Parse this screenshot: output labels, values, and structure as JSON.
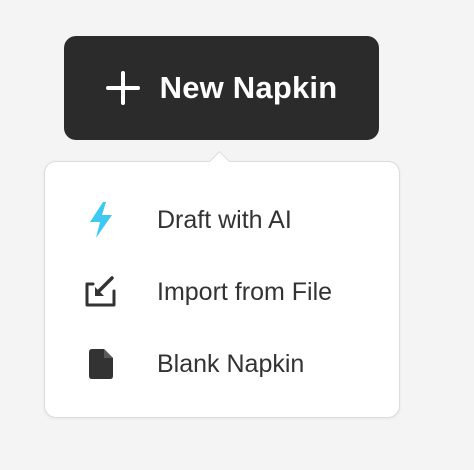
{
  "new_button": {
    "label": "New Napkin",
    "icon": "plus-icon"
  },
  "menu": {
    "items": [
      {
        "label": "Draft with AI",
        "icon": "lightning-icon",
        "icon_color": "#3ec9f2"
      },
      {
        "label": "Import from File",
        "icon": "import-icon",
        "icon_color": "#333333"
      },
      {
        "label": "Blank Napkin",
        "icon": "document-icon",
        "icon_color": "#333333"
      }
    ]
  },
  "colors": {
    "background": "#f4f4f4",
    "button_bg": "#2b2b2b",
    "menu_bg": "#ffffff",
    "accent": "#3ec9f2"
  }
}
